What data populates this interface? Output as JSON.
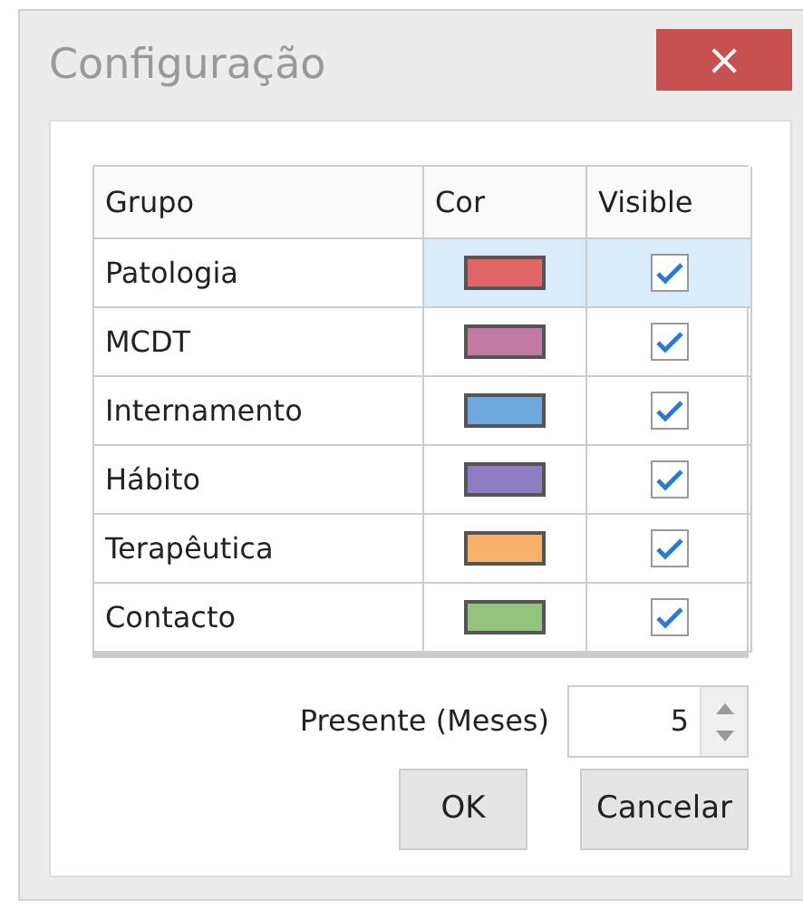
{
  "window": {
    "title": "Configuração",
    "close": "×"
  },
  "table": {
    "columns": [
      "Grupo",
      "Cor",
      "Visible"
    ],
    "rows": [
      {
        "group": "Patologia",
        "color": "#e06666",
        "visible": true,
        "selected": true
      },
      {
        "group": "MCDT",
        "color": "#c27ba0",
        "visible": true,
        "selected": false
      },
      {
        "group": "Internamento",
        "color": "#6fa8dc",
        "visible": true,
        "selected": false
      },
      {
        "group": "Hábito",
        "color": "#8e7cc3",
        "visible": true,
        "selected": false
      },
      {
        "group": "Terapêutica",
        "color": "#f6b26b",
        "visible": true,
        "selected": false
      },
      {
        "group": "Contacto",
        "color": "#93c47d",
        "visible": true,
        "selected": false
      }
    ]
  },
  "months": {
    "label": "Presente (Meses)",
    "value": "5"
  },
  "buttons": [
    "OK",
    "Cancelar"
  ]
}
